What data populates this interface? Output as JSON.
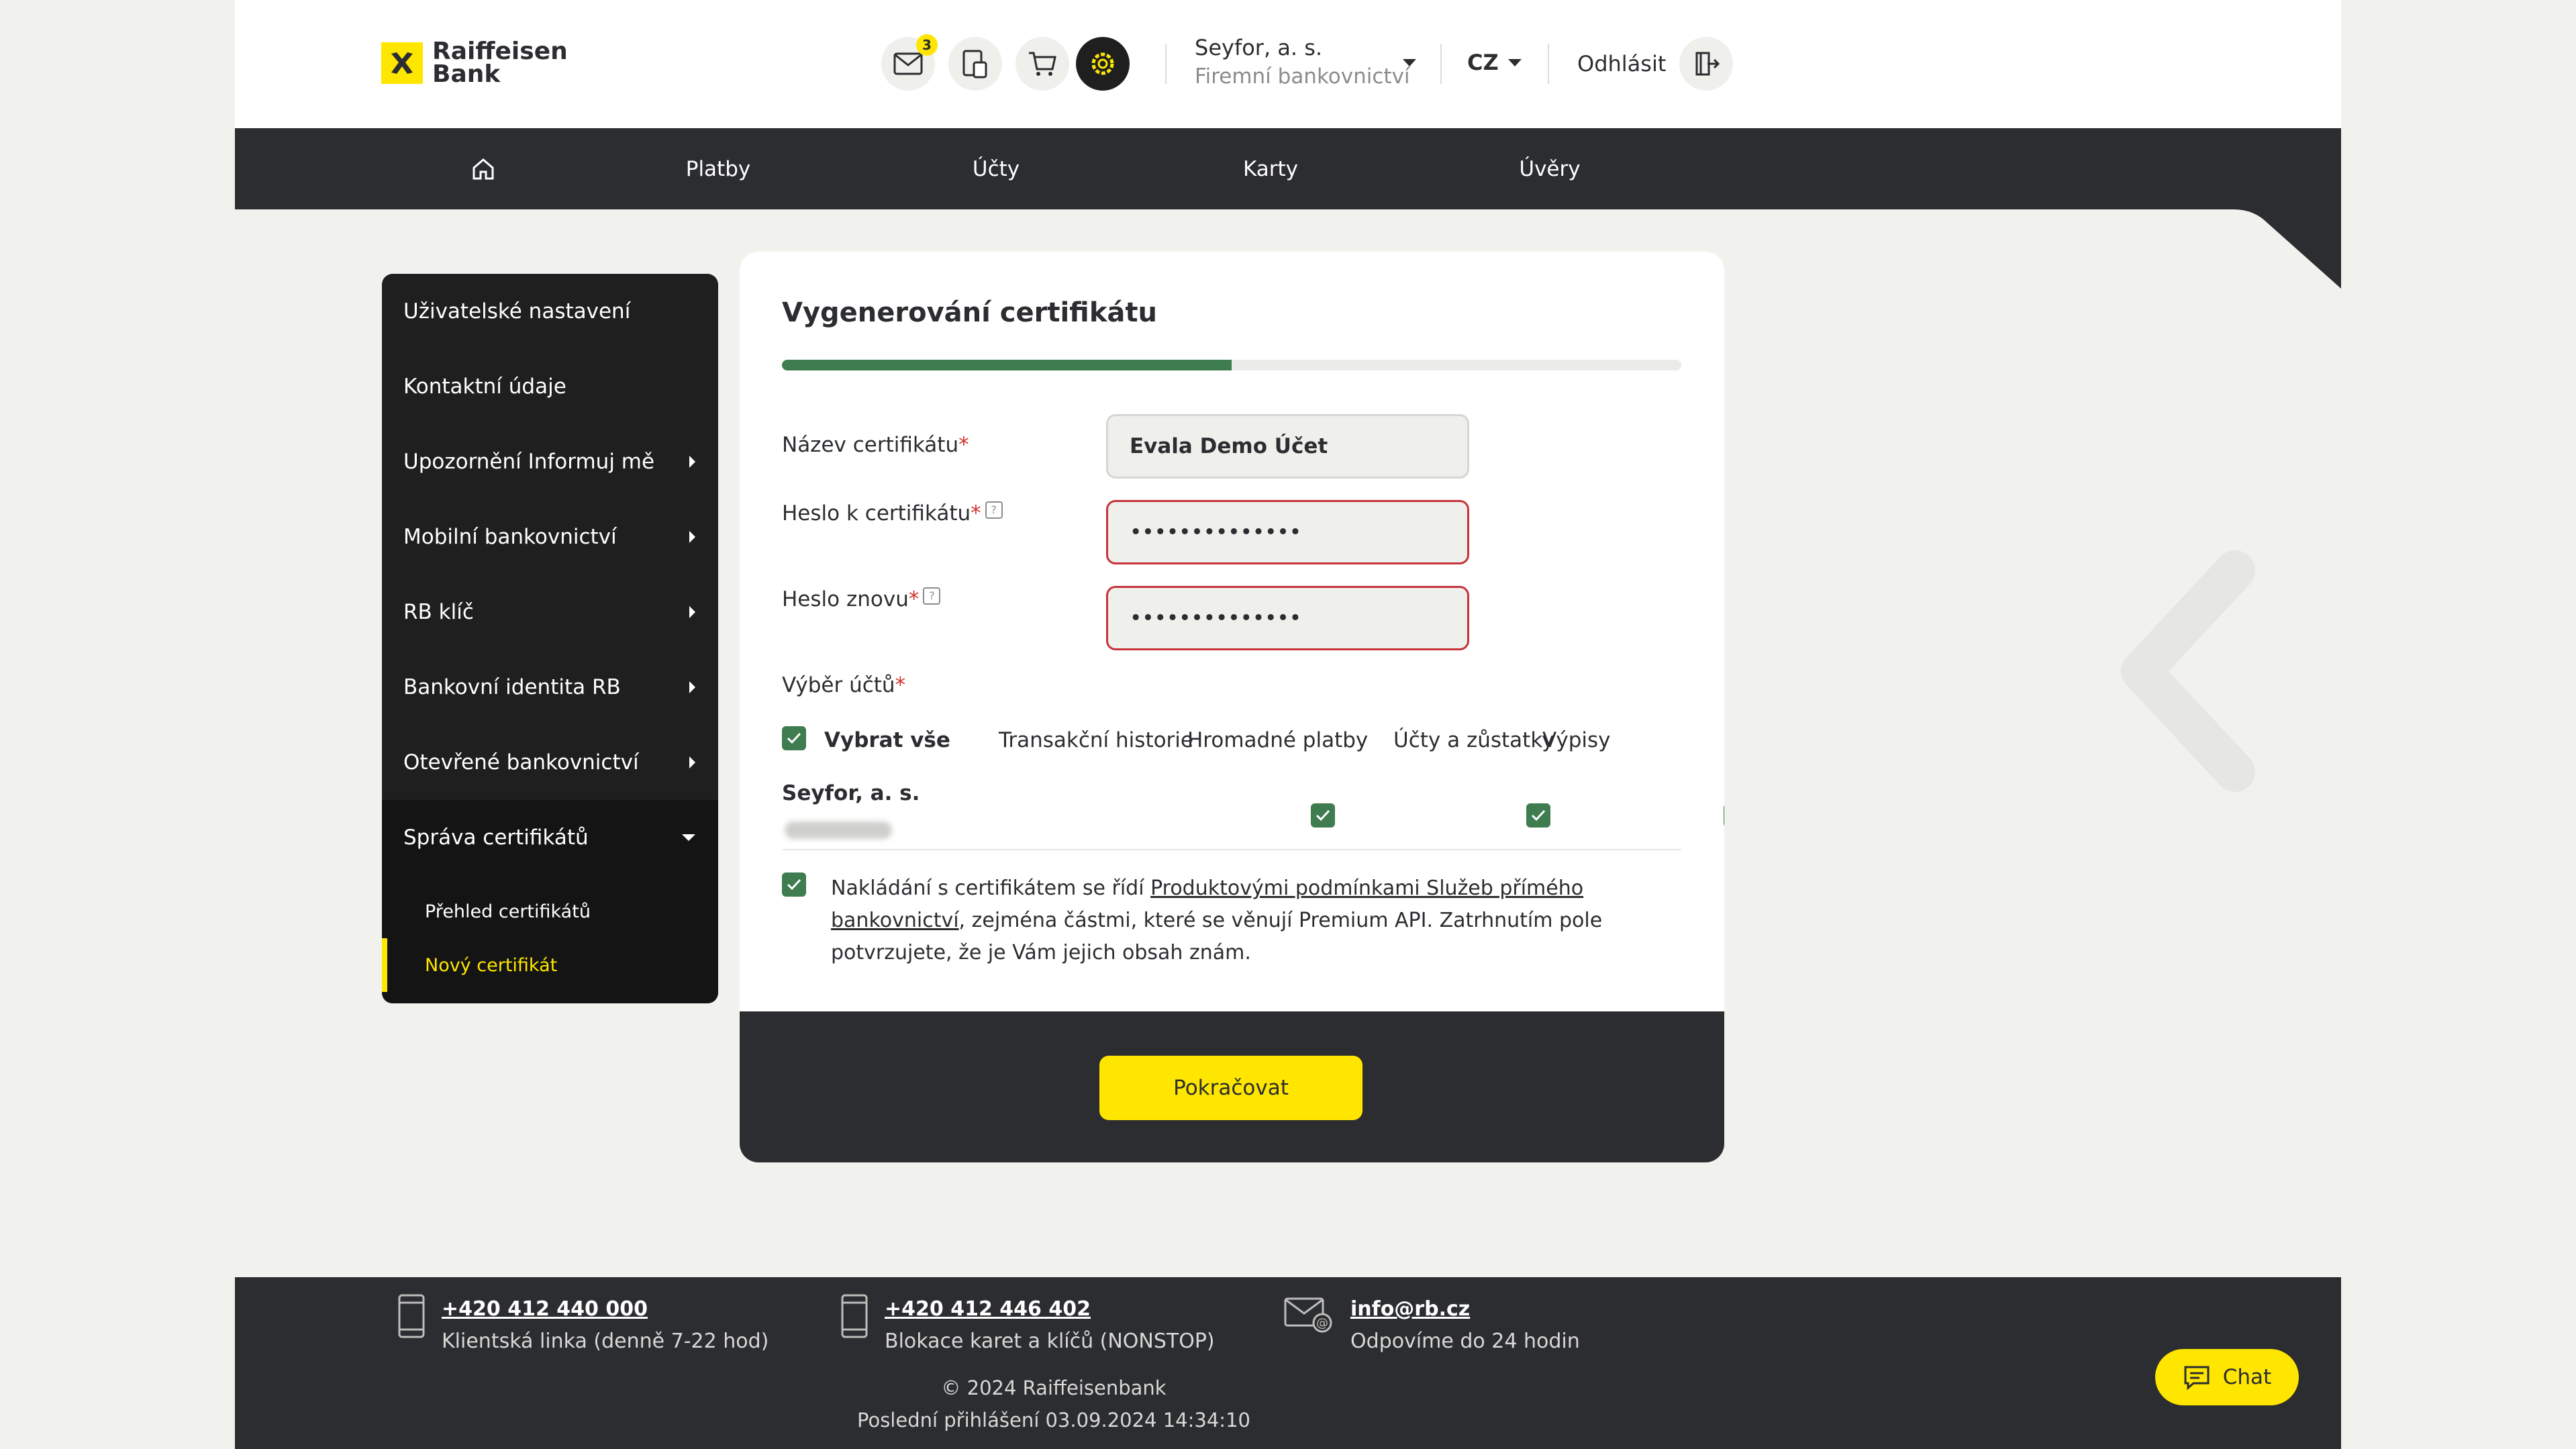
{
  "brand": {
    "logo_line1": "Raiffeisen",
    "logo_line2": "Bank",
    "accent": "#fee600",
    "dark": "#2b2d30",
    "success": "#3f7c4f",
    "error": "#c8323a"
  },
  "header": {
    "messages_icon": "mail-icon",
    "messages_badge": "3",
    "icons": [
      "mail-icon",
      "documents-icon",
      "cart-icon",
      "settings-icon"
    ],
    "company_name": "Seyfor, a. s.",
    "company_sub": "Firemní bankovnictví",
    "language": "CZ",
    "logout_label": "Odhlásit"
  },
  "nav": {
    "items": [
      "Platby",
      "Účty",
      "Karty",
      "Úvěry"
    ],
    "home_icon": "home-icon"
  },
  "sidebar": {
    "items": [
      {
        "label": "Uživatelské nastavení",
        "arrow": false
      },
      {
        "label": "Kontaktní údaje",
        "arrow": false
      },
      {
        "label": "Upozornění Informuj mě",
        "arrow": true
      },
      {
        "label": "Mobilní bankovnictví",
        "arrow": true
      },
      {
        "label": "RB klíč",
        "arrow": true
      },
      {
        "label": "Bankovní identita RB",
        "arrow": true
      },
      {
        "label": "Otevřené bankovnictví",
        "arrow": true
      },
      {
        "label": "Správa certifikátů",
        "arrow": "down"
      }
    ],
    "subitems": [
      "Přehled certifikátů",
      "Nový certifikát"
    ],
    "current_subitem": "Nový certifikát"
  },
  "form": {
    "title": "Vygenerování certifikátu",
    "progress": 0.5,
    "fields": [
      {
        "label": "Název certifikátu",
        "value": "Evala Demo Účet"
      },
      {
        "label": "Heslo k certifikátu",
        "value": "••••••••••••••"
      },
      {
        "label": "Heslo znovu",
        "value": "••••••••••••••"
      }
    ],
    "required_mark": "*",
    "accounts_label": "Výběr účtů",
    "select_all": "Vybrat vše",
    "columns": [
      "Transakční historie",
      "Hromadné platby",
      "Účty a zůstatky",
      "Výpisy"
    ],
    "account_name": "Seyfor, a. s.",
    "terms_pre": "Nakládání s certifikátem se řídí ",
    "terms_link": "Produktovými podmínkami Služeb přímého bankovnictví",
    "terms_post": ", zejména částmi, které se věnují Premium API. Zatrhnutím pole potvrzujete, že je Vám jejich obsah znám.",
    "continue_label": "Pokračovat"
  },
  "footer": {
    "contacts": [
      {
        "icon": "phone-icon",
        "link": "+420 412 440 000",
        "desc": "Klientská linka (denně 7-22 hod)"
      },
      {
        "icon": "phone-icon",
        "link": "+420 412 446 402",
        "desc": "Blokace karet a klíčů (NONSTOP)"
      },
      {
        "icon": "email-icon",
        "link": "info@rb.cz",
        "desc": "Odpovíme do 24 hodin"
      }
    ],
    "copyright": "© 2024 Raiffeisenbank",
    "last_login": "Poslední přihlášení 03.09.2024  14:34:10"
  },
  "chat": {
    "label": "Chat",
    "icon": "chat-icon"
  }
}
